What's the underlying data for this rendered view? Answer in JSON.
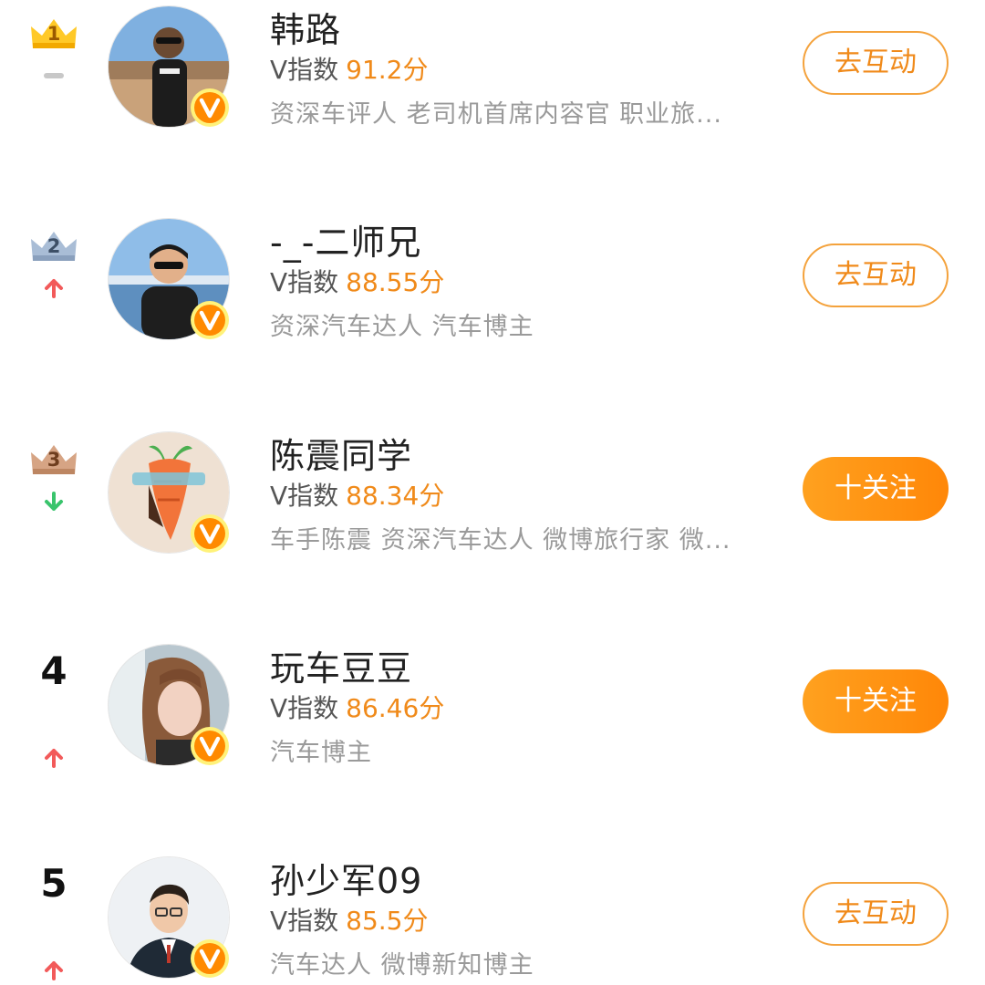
{
  "score_label": "V指数",
  "colors": {
    "accent": "#f08a1a",
    "trend_up": "#f25a5a",
    "trend_down": "#39c46c",
    "trend_flat": "#c8c8c8",
    "gold_crown": "#ffc928",
    "silver_crown": "#a9bdd6",
    "bronze_crown": "#d6a484",
    "verified_badge": "#ff8a00"
  },
  "entries": [
    {
      "rank": "1",
      "trend": "flat",
      "crown": "gold",
      "name": "韩路",
      "score": "91.2分",
      "desc": "资深车评人 老司机首席内容官 职业旅...",
      "action": "去互动",
      "action_style": "outline",
      "avatar_icon": "man-sunglasses-outdoor-avatar"
    },
    {
      "rank": "2",
      "trend": "up",
      "crown": "silver",
      "name": "-_-二师兄",
      "score": "88.55分",
      "desc": "资深汽车达人 汽车博主",
      "action": "去互动",
      "action_style": "outline",
      "avatar_icon": "man-hoodie-beach-avatar"
    },
    {
      "rank": "3",
      "trend": "down",
      "crown": "bronze",
      "name": "陈震同学",
      "score": "88.34分",
      "desc": "车手陈震 资深汽车达人 微博旅行家 微...",
      "action": "十关注",
      "action_style": "filled",
      "avatar_icon": "carrot-tattoo-avatar"
    },
    {
      "rank": "4",
      "trend": "up",
      "crown": "",
      "name": "玩车豆豆",
      "score": "86.46分",
      "desc": "汽车博主",
      "action": "十关注",
      "action_style": "filled",
      "avatar_icon": "woman-portrait-avatar"
    },
    {
      "rank": "5",
      "trend": "up",
      "crown": "",
      "name": "孙少军09",
      "score": "85.5分",
      "desc": "汽车达人 微博新知博主",
      "action": "去互动",
      "action_style": "outline",
      "avatar_icon": "man-suit-avatar"
    }
  ]
}
